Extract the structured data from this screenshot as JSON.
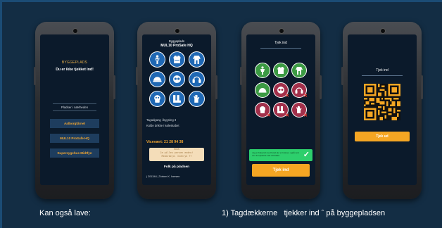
{
  "phone1": {
    "title": "BYGGEPLADS",
    "subtitle": "Du er ikke tjekket ind!",
    "places_label": "Pladser i nærheden",
    "places": [
      "Aalborgtårnet",
      "MUL10 ProSafe HQ",
      "Supersygehus Midtfyn"
    ]
  },
  "phone2": {
    "header": "Byggeplads",
    "name": "MUL10 ProSafe HQ",
    "ppe_icons": [
      "harness-icon",
      "vest-icon",
      "coverall-icon",
      "helmet-icon",
      "goggles-icon",
      "ear-protection-icon",
      "mask-icon",
      "boots-icon",
      "gloves-icon"
    ],
    "info_lines": [
      "Tagadgang i bygning 3",
      "Kolde drikke i køleskabet"
    ],
    "vicevaert": "Vicevært: 21 28 94 38",
    "note_lines": [
      "HUSK",
      "Ja pilles persen endnu!",
      "Medarbejd. Indtryk ??"
    ],
    "people_label": "Folk på pladsen",
    "footer": "| 201344 | Torben K. Iversen"
  },
  "phone3": {
    "title": "Tjek ind",
    "icons": [
      {
        "name": "harness-icon",
        "status": "ok"
      },
      {
        "name": "vest-icon",
        "status": "ok"
      },
      {
        "name": "coverall-icon",
        "status": "ok"
      },
      {
        "name": "helmet-icon",
        "status": "ok"
      },
      {
        "name": "goggles-icon",
        "status": "missing"
      },
      {
        "name": "ear-protection-icon",
        "status": "missing"
      },
      {
        "name": "mask-icon",
        "status": "missing"
      },
      {
        "name": "boots-icon",
        "status": "missing"
      },
      {
        "name": "gloves-icon",
        "status": "missing"
      }
    ],
    "alert": "Jeg er bekendt med hvad der er krævet, også selv om de trykkede sæt af blokke.",
    "button": "Tjek ind"
  },
  "phone4": {
    "title": "Tjek ind",
    "button": "Tjek ud"
  },
  "caption_left": "Kan også lave:",
  "caption_right": "1) Tagdækkerne   tjekker ind ˆ på byggepladsen",
  "colors": {
    "accent": "#f5a623",
    "ppe_blue": "#1f68b4",
    "ok_green": "#3c9a43",
    "missing_red": "#a2304b",
    "background": "#132d44"
  }
}
